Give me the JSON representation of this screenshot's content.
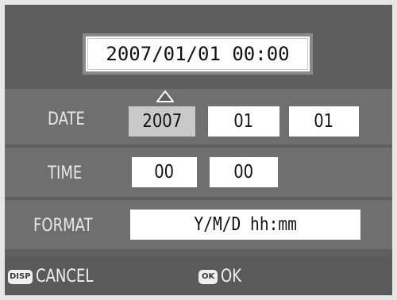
{
  "preview": {
    "datetime": "2007/01/01 00:00"
  },
  "date": {
    "label": "DATE",
    "year": "2007",
    "month": "01",
    "day": "01",
    "selected_field": "year"
  },
  "time": {
    "label": "TIME",
    "hour": "00",
    "minute": "00"
  },
  "format": {
    "label": "FORMAT",
    "value": "Y/M/D hh:mm"
  },
  "buttons": {
    "cancel_key": "DISP",
    "cancel_label": "CANCEL",
    "ok_key": "OK",
    "ok_label": "OK"
  },
  "colors": {
    "background": "#5e5e5e",
    "row_band": "#6f6f6f",
    "field": "#ffffff",
    "selected_field": "#c9c9c9"
  },
  "icons": {
    "selection_cursor": "up-arrow-outline-icon"
  }
}
